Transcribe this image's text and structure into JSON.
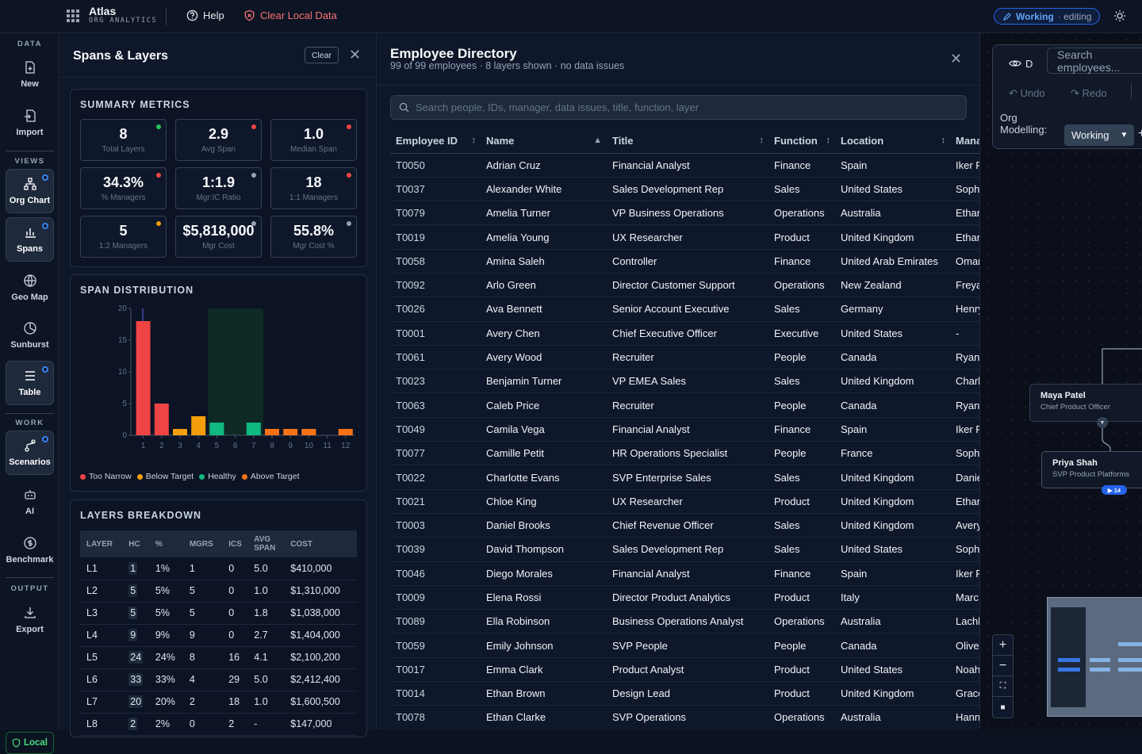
{
  "app": {
    "brand": "Atlas",
    "brand_sub": "ORG ANALYTICS",
    "help": "Help",
    "clear_local": "Clear Local Data",
    "mode_working": "Working",
    "mode_editing": "· editing"
  },
  "rail": {
    "sections": [
      "DATA",
      "VIEWS",
      "WORK",
      "OUTPUT"
    ],
    "items": [
      {
        "label": "New",
        "icon": "file-plus-icon"
      },
      {
        "label": "Import",
        "icon": "import-icon"
      },
      {
        "label": "Org Chart",
        "icon": "org-chart-icon"
      },
      {
        "label": "Spans",
        "icon": "bar-chart-icon"
      },
      {
        "label": "Geo Map",
        "icon": "globe-icon"
      },
      {
        "label": "Sunburst",
        "icon": "sunburst-icon"
      },
      {
        "label": "Table",
        "icon": "table-icon"
      },
      {
        "label": "Scenarios",
        "icon": "branch-icon"
      },
      {
        "label": "AI",
        "icon": "robot-icon"
      },
      {
        "label": "Benchmark",
        "icon": "dollar-icon"
      },
      {
        "label": "Export",
        "icon": "download-icon"
      }
    ],
    "local": "Local"
  },
  "spans_panel": {
    "title": "Spans & Layers",
    "clear": "Clear",
    "summary_title": "SUMMARY METRICS",
    "metrics": [
      {
        "value": "8",
        "label": "Total Layers",
        "status": "#22c55e"
      },
      {
        "value": "2.9",
        "label": "Avg Span",
        "status": "#ef4444"
      },
      {
        "value": "1.0",
        "label": "Median Span",
        "status": "#ef4444"
      },
      {
        "value": "34.3%",
        "label": "% Managers",
        "status": "#ef4444"
      },
      {
        "value": "1:1.9",
        "label": "Mgr:IC Ratio",
        "status": "#94a3b8"
      },
      {
        "value": "18",
        "label": "1:1 Managers",
        "status": "#ef4444"
      },
      {
        "value": "5",
        "label": "1:2 Managers",
        "status": "#f59e0b"
      },
      {
        "value": "$5,818,000",
        "label": "Mgr Cost",
        "status": "#94a3b8"
      },
      {
        "value": "55.8%",
        "label": "Mgr Cost %",
        "status": "#94a3b8"
      }
    ],
    "span_title": "SPAN DISTRIBUTION",
    "legend": [
      {
        "label": "Too Narrow",
        "color": "#ef4444"
      },
      {
        "label": "Below Target",
        "color": "#f59e0b"
      },
      {
        "label": "Healthy",
        "color": "#10b981"
      },
      {
        "label": "Above Target",
        "color": "#f97316"
      }
    ],
    "layers_title": "LAYERS BREAKDOWN",
    "layer_headers": [
      "LAYER",
      "HC",
      "%",
      "MGRS",
      "ICS",
      "AVG SPAN",
      "COST"
    ],
    "layers": [
      [
        "L1",
        "1",
        "1%",
        "1",
        "0",
        "5.0",
        "$410,000"
      ],
      [
        "L2",
        "5",
        "5%",
        "5",
        "0",
        "1.0",
        "$1,310,000"
      ],
      [
        "L3",
        "5",
        "5%",
        "5",
        "0",
        "1.8",
        "$1,038,000"
      ],
      [
        "L4",
        "9",
        "9%",
        "9",
        "0",
        "2.7",
        "$1,404,000"
      ],
      [
        "L5",
        "24",
        "24%",
        "8",
        "16",
        "4.1",
        "$2,100,200"
      ],
      [
        "L6",
        "33",
        "33%",
        "4",
        "29",
        "5.0",
        "$2,412,400"
      ],
      [
        "L7",
        "20",
        "20%",
        "2",
        "18",
        "1.0",
        "$1,600,500"
      ],
      [
        "L8",
        "2",
        "2%",
        "0",
        "2",
        "-",
        "$147,000"
      ]
    ]
  },
  "chart_data": {
    "type": "bar",
    "categories": [
      "1",
      "2",
      "3",
      "4",
      "5",
      "6",
      "7",
      "8",
      "9",
      "10",
      "11",
      "12"
    ],
    "values": [
      18,
      5,
      1,
      3,
      2,
      0,
      2,
      1,
      1,
      1,
      0,
      1
    ],
    "colors": [
      "#ef4444",
      "#ef4444",
      "#f59e0b",
      "#f59e0b",
      "#10b981",
      "#10b981",
      "#10b981",
      "#f97316",
      "#f97316",
      "#f97316",
      "#f97316",
      "#f97316"
    ],
    "ylim": [
      0,
      20
    ],
    "yticks": [
      "0",
      "5",
      "10",
      "15",
      "20"
    ],
    "healthy_band": [
      5,
      8
    ]
  },
  "directory": {
    "title": "Employee Directory",
    "subtitle": "99 of 99 employees · 8 layers shown · no data issues",
    "search_placeholder": "Search people, IDs, manager, data issues, title, function, layer",
    "columns": [
      "Employee ID",
      "Name",
      "Title",
      "Function",
      "Location",
      "Mana"
    ],
    "rows": [
      [
        "T0050",
        "Adrian Cruz",
        "Financial Analyst",
        "Finance",
        "Spain",
        "Iker R"
      ],
      [
        "T0037",
        "Alexander White",
        "Sales Development Rep",
        "Sales",
        "United States",
        "Soph"
      ],
      [
        "T0079",
        "Amelia Turner",
        "VP Business Operations",
        "Operations",
        "Australia",
        "Ethar"
      ],
      [
        "T0019",
        "Amelia Young",
        "UX Researcher",
        "Product",
        "United Kingdom",
        "Ethar"
      ],
      [
        "T0058",
        "Amina Saleh",
        "Controller",
        "Finance",
        "United Arab Emirates",
        "Omar"
      ],
      [
        "T0092",
        "Arlo Green",
        "Director Customer Support",
        "Operations",
        "New Zealand",
        "Freya"
      ],
      [
        "T0026",
        "Ava Bennett",
        "Senior Account Executive",
        "Sales",
        "Germany",
        "Henry"
      ],
      [
        "T0001",
        "Avery Chen",
        "Chief Executive Officer",
        "Executive",
        "United States",
        "-"
      ],
      [
        "T0061",
        "Avery Wood",
        "Recruiter",
        "People",
        "Canada",
        "Ryan"
      ],
      [
        "T0023",
        "Benjamin Turner",
        "VP EMEA Sales",
        "Sales",
        "United Kingdom",
        "Charl"
      ],
      [
        "T0063",
        "Caleb Price",
        "Recruiter",
        "People",
        "Canada",
        "Ryan"
      ],
      [
        "T0049",
        "Camila Vega",
        "Financial Analyst",
        "Finance",
        "Spain",
        "Iker R"
      ],
      [
        "T0077",
        "Camille Petit",
        "HR Operations Specialist",
        "People",
        "France",
        "Soph"
      ],
      [
        "T0022",
        "Charlotte Evans",
        "SVP Enterprise Sales",
        "Sales",
        "United Kingdom",
        "Danie"
      ],
      [
        "T0021",
        "Chloe King",
        "UX Researcher",
        "Product",
        "United Kingdom",
        "Ethar"
      ],
      [
        "T0003",
        "Daniel Brooks",
        "Chief Revenue Officer",
        "Sales",
        "United Kingdom",
        "Avery"
      ],
      [
        "T0039",
        "David Thompson",
        "Sales Development Rep",
        "Sales",
        "United States",
        "Soph"
      ],
      [
        "T0046",
        "Diego Morales",
        "Financial Analyst",
        "Finance",
        "Spain",
        "Iker R"
      ],
      [
        "T0009",
        "Elena Rossi",
        "Director Product Analytics",
        "Product",
        "Italy",
        "Marc"
      ],
      [
        "T0089",
        "Ella Robinson",
        "Business Operations Analyst",
        "Operations",
        "Australia",
        "Lachl"
      ],
      [
        "T0059",
        "Emily Johnson",
        "SVP People",
        "People",
        "Canada",
        "Olive"
      ],
      [
        "T0017",
        "Emma Clark",
        "Product Analyst",
        "Product",
        "United States",
        "Noah"
      ],
      [
        "T0014",
        "Ethan Brown",
        "Design Lead",
        "Product",
        "United Kingdom",
        "Grace"
      ],
      [
        "T0078",
        "Ethan Clarke",
        "SVP Operations",
        "Operations",
        "Australia",
        "Hann"
      ]
    ]
  },
  "canvas": {
    "search_placeholder": "Search employees...",
    "eye_label": "D",
    "undo": "Undo",
    "redo": "Redo",
    "org_modelling": "Org Modelling:",
    "mode_select": "Working",
    "nodes": [
      {
        "name": "Maya Patel",
        "title": "Chief Product Officer"
      },
      {
        "name": "Priya Shah",
        "title": "SVP Product Platforms",
        "badge": "▶ 14"
      }
    ]
  }
}
